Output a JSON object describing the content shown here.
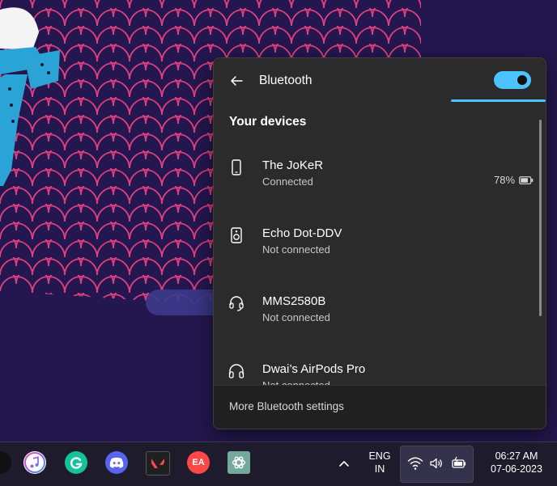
{
  "bluetooth_flyout": {
    "title": "Bluetooth",
    "toggle_on": true,
    "section_title": "Your devices",
    "devices": [
      {
        "name": "The JoKeR",
        "status": "Connected",
        "icon": "phone-icon",
        "battery": "78%"
      },
      {
        "name": "Echo Dot-DDV",
        "status": "Not connected",
        "icon": "speaker-icon"
      },
      {
        "name": "MMS2580B",
        "status": "Not connected",
        "icon": "headset-icon"
      },
      {
        "name": "Dwai’s AirPods Pro",
        "status": "Not connected",
        "icon": "headphones-icon"
      }
    ],
    "footer_link": "More Bluetooth settings"
  },
  "taskbar": {
    "apps": [
      {
        "name": "itunes",
        "icon": "itunes-icon"
      },
      {
        "name": "grammarly",
        "icon": "grammarly-icon"
      },
      {
        "name": "discord",
        "icon": "discord-icon"
      },
      {
        "name": "valorant",
        "icon": "valorant-icon"
      },
      {
        "name": "ea",
        "icon": "ea-icon",
        "label": "EA"
      },
      {
        "name": "chatgpt",
        "icon": "chatgpt-icon"
      }
    ],
    "lang_line1": "ENG",
    "lang_line2": "IN",
    "time": "06:27 AM",
    "date": "07-06-2023"
  },
  "colors": {
    "accent": "#4cc2ff",
    "wallpaper": "#24174f",
    "scales": "#e0407f",
    "flyout_bg": "#2b2b2b"
  }
}
